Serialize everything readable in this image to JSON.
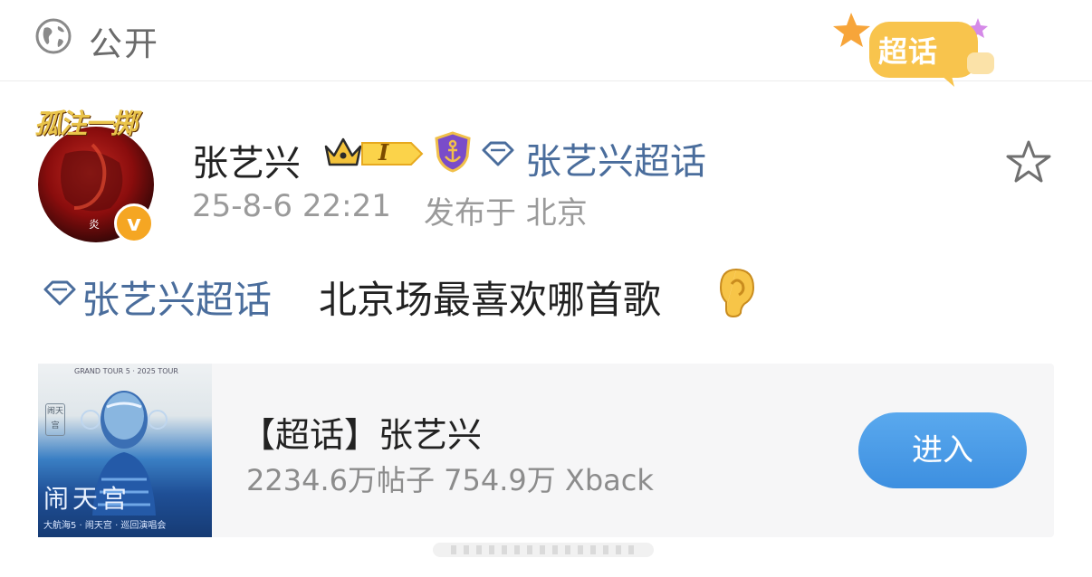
{
  "header": {
    "visibility_label": "公开",
    "supertopic_logo_text": "超话"
  },
  "author": {
    "name": "张艺兴",
    "avatar_title": "孤注一掷",
    "verified_mark": "v",
    "level_text": "I",
    "topic_link": "张艺兴超话",
    "post_time": "25-8-6 22:21",
    "location": "发布于 北京"
  },
  "post": {
    "topic_link": "张艺兴超话",
    "text": "北京场最喜欢哪首歌",
    "emoji": "ear-icon"
  },
  "card": {
    "title": "【超话】张艺兴",
    "stats": "2234.6万帖子 754.9万 Xback",
    "enter_label": "进入",
    "cover_caption": "闹天宫",
    "cover_small": "大航海5 · 闹天宫 · 巡回演唱会",
    "cover_header": "GRAND TOUR 5 · 2025 TOUR",
    "cover_side": "闹天宫"
  },
  "colors": {
    "link_blue": "#4a6d9c",
    "enter_button": "#4a9be8",
    "verified_orange": "#f5a623"
  }
}
